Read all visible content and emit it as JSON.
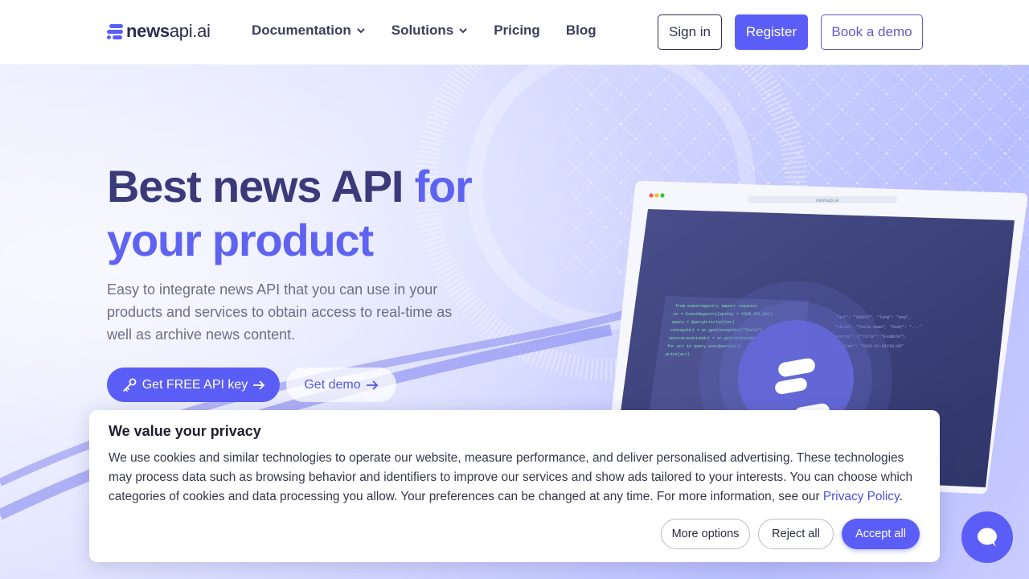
{
  "header": {
    "logo_bold": "news",
    "logo_light": "api.ai",
    "nav": [
      {
        "label": "Documentation",
        "has_dropdown": true
      },
      {
        "label": "Solutions",
        "has_dropdown": true
      },
      {
        "label": "Pricing",
        "has_dropdown": false
      },
      {
        "label": "Blog",
        "has_dropdown": false
      }
    ],
    "signin_label": "Sign in",
    "register_label": "Register",
    "book_demo_label": "Book a demo"
  },
  "hero": {
    "title_part1": "Best news API ",
    "title_accent1": "for",
    "title_accent2": "your product",
    "subtitle": "Easy to integrate news API that you can use in your products and services to obtain access to real-time as well as archive news content.",
    "cta_primary": "Get FREE API key",
    "cta_secondary": "Get demo",
    "mock_url": "newsapi.ai"
  },
  "cookie": {
    "title": "We value your privacy",
    "text": "We use cookies and similar technologies to operate our website, measure performance, and deliver personalised advertising. These technologies may process data such as browsing behavior and identifiers to improve our services and show ads tailored to your interests. You can choose which categories of cookies and data processing you allow. Your preferences can be changed at any time. For more information, see our ",
    "link_label": "Privacy Policy",
    "text_end": ".",
    "more_options": "More options",
    "reject_all": "Reject all",
    "accept_all": "Accept all"
  },
  "colors": {
    "brand": "#5b5ef6",
    "title_dark": "#3a3a7a",
    "title_accent": "#5f63f2"
  }
}
